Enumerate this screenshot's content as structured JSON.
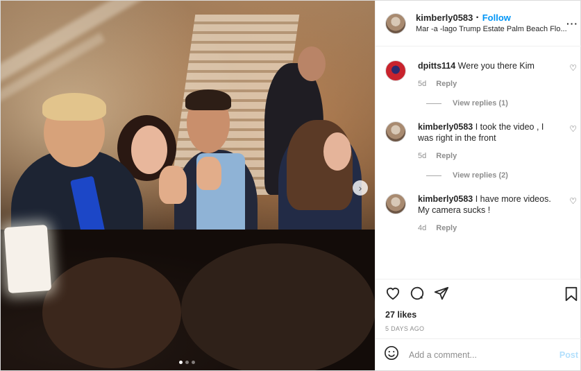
{
  "post": {
    "username": "kimberly0583",
    "follow_label": "Follow",
    "location": "Mar -a -lago Trump Estate Palm Beach Flo...",
    "more_glyph": "···"
  },
  "comments": [
    {
      "username": "dpitts114",
      "text": "Were you there Kim",
      "age": "5d",
      "reply_label": "Reply",
      "view_replies": "View replies (1)"
    },
    {
      "username": "kimberly0583",
      "text": "I took the video , I was right in the front",
      "age": "5d",
      "reply_label": "Reply",
      "view_replies": "View replies (2)"
    },
    {
      "username": "kimberly0583",
      "text": "I have more videos. My camera sucks !",
      "age": "4d",
      "reply_label": "Reply"
    }
  ],
  "actions": {
    "likes": "27 likes",
    "time_ago": "5 DAYS AGO"
  },
  "add_comment": {
    "placeholder": "Add a comment...",
    "post_label": "Post"
  },
  "icons": {
    "like": "heart-icon",
    "comment": "comment-bubble-icon",
    "share": "paper-plane-icon",
    "save": "bookmark-icon",
    "emoji": "smiley-icon",
    "next": "chevron-right-icon"
  },
  "colors": {
    "accent": "#0095f6",
    "post_disabled": "#b2dffc",
    "muted": "#8e8e8e"
  },
  "carousel": {
    "slides": 3,
    "active": 1
  }
}
